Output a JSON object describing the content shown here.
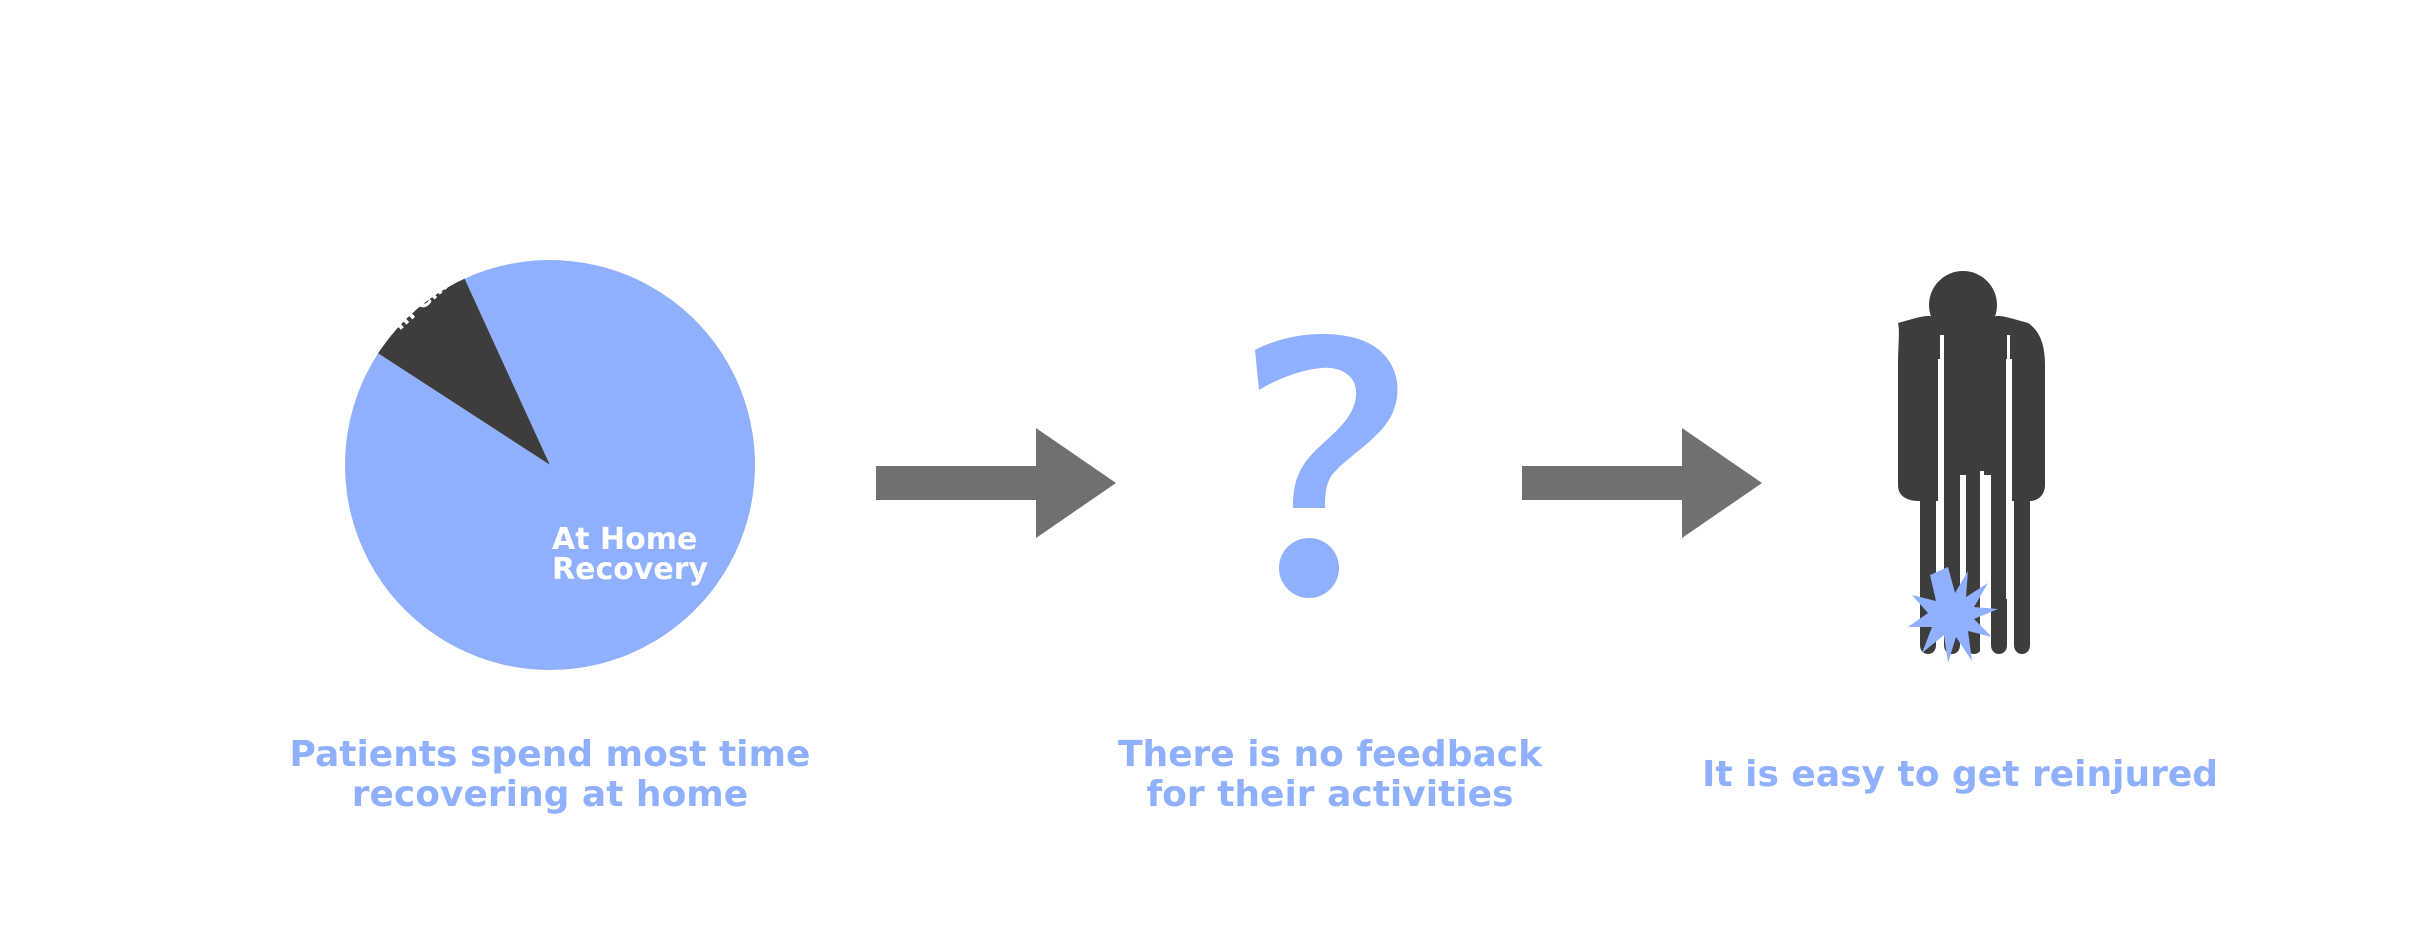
{
  "pie": {
    "in_clinic_label": "In Clinic",
    "at_home_line1": "At Home",
    "at_home_line2": "Recovery"
  },
  "chart_data": {
    "type": "pie",
    "categories": [
      "In Clinic",
      "At Home Recovery"
    ],
    "values": [
      9,
      91
    ],
    "colors": [
      "#3d3d3d",
      "#8fb0fc"
    ]
  },
  "captions": {
    "step1": {
      "line1": "Patients spend most time",
      "line2": "recovering at home"
    },
    "step2": {
      "line1": "There is no feedback",
      "line2": "for their activities"
    },
    "step3": {
      "line1": "It is easy to get reinjured"
    }
  },
  "icons": {
    "arrow": "right-arrow-icon",
    "question": "question-mark-icon",
    "person": "injured-person-icon",
    "injury": "injury-burst-icon"
  },
  "colors": {
    "accent_blue": "#8fb0fc",
    "dark_gray": "#3d3d3d",
    "arrow_gray": "#707070"
  }
}
